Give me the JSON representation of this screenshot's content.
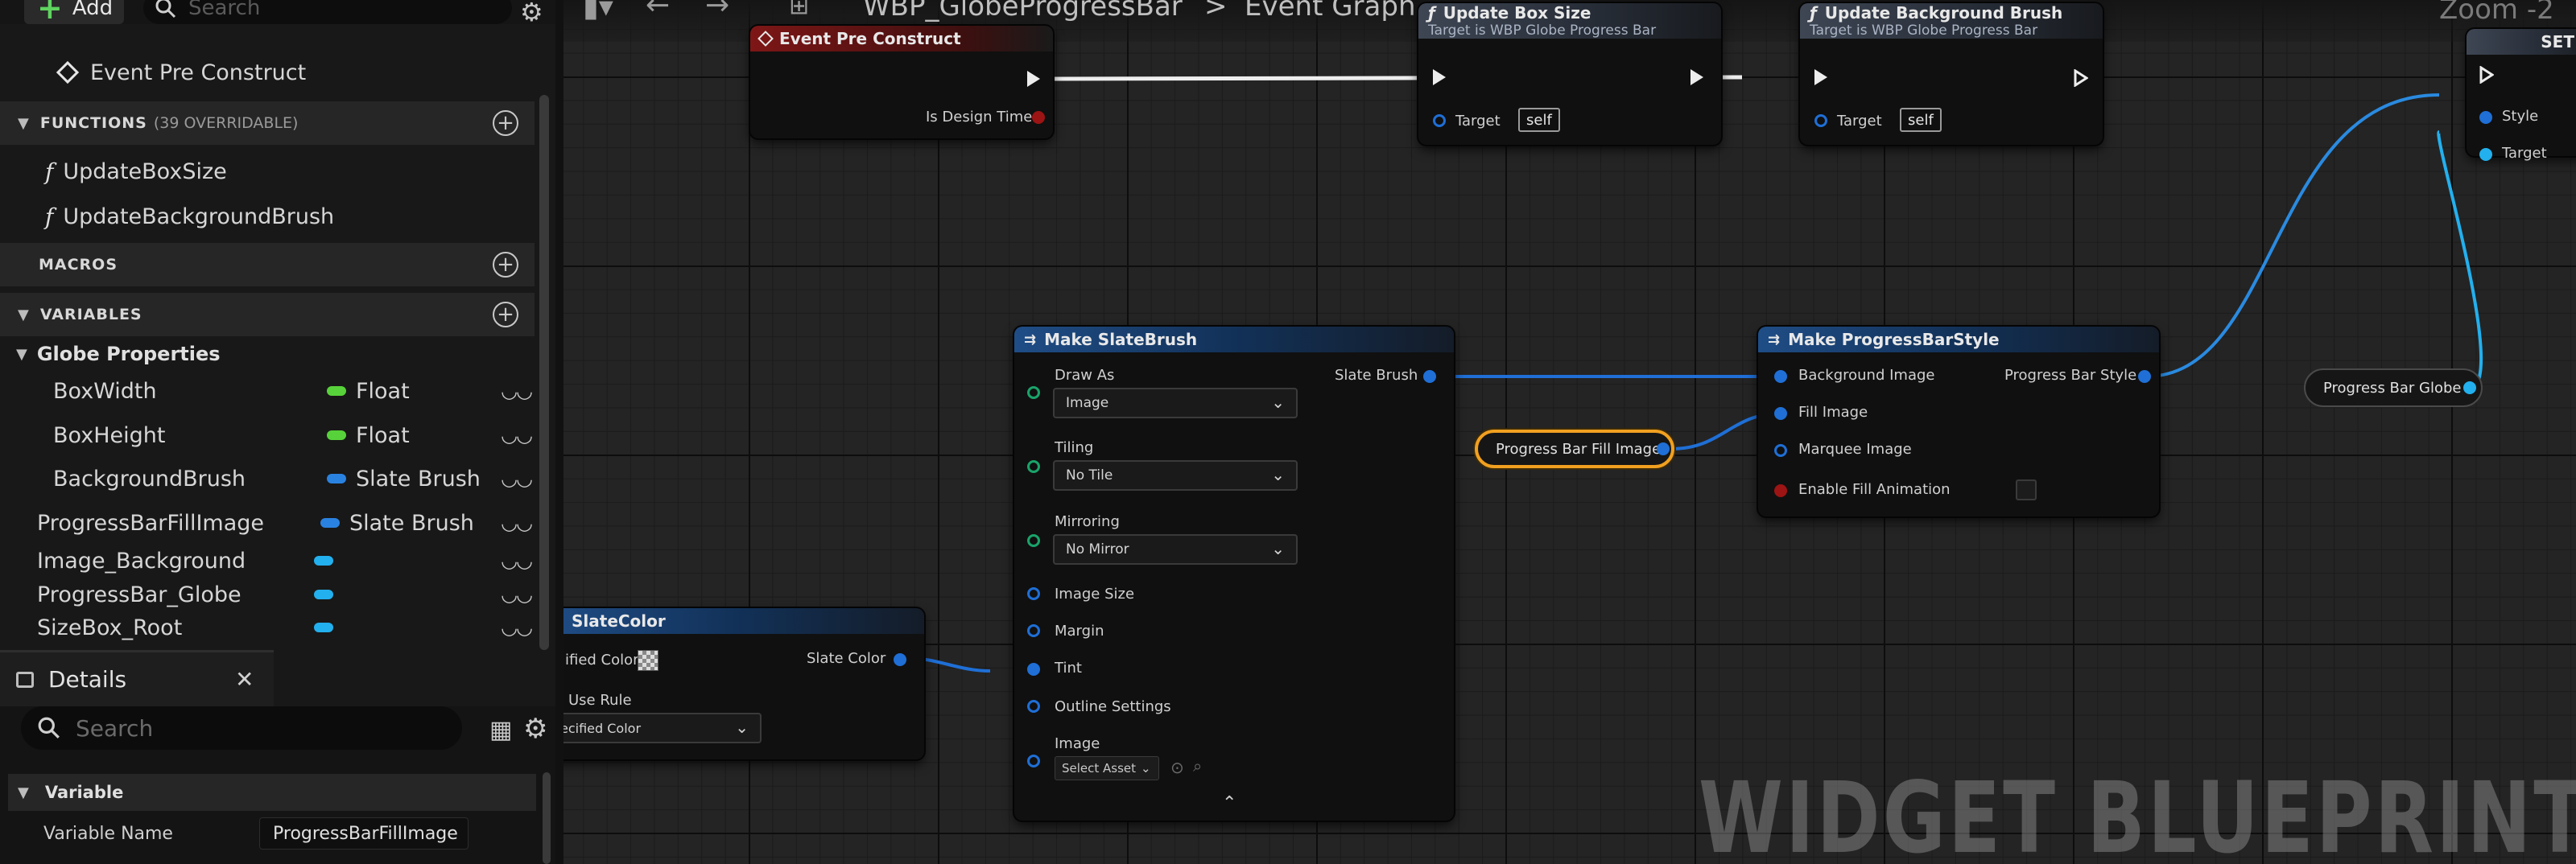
{
  "toolbar": {
    "add_label": "Add",
    "search_placeholder": "Search"
  },
  "my_blueprint": {
    "event_item": "Event Pre Construct",
    "functions_header": "FUNCTIONS",
    "functions_count": "(39 OVERRIDABLE)",
    "functions": [
      "UpdateBoxSize",
      "UpdateBackgroundBrush"
    ],
    "macros_header": "MACROS",
    "variables_header": "VARIABLES",
    "category": "Globe Properties",
    "variables": [
      {
        "name": "BoxWidth",
        "type": "Float"
      },
      {
        "name": "BoxHeight",
        "type": "Float"
      },
      {
        "name": "BackgroundBrush",
        "type": "Slate Brush"
      },
      {
        "name": "ProgressBarFillImage",
        "type": "Slate Brush"
      },
      {
        "name": "Image_Background",
        "type": ""
      },
      {
        "name": "ProgressBar_Globe",
        "type": ""
      },
      {
        "name": "SizeBox_Root",
        "type": ""
      }
    ]
  },
  "details": {
    "tab_label": "Details",
    "search_placeholder": "Search",
    "section": "Variable",
    "variable_name_label": "Variable Name",
    "variable_name_value": "ProgressBarFillImage"
  },
  "graph": {
    "breadcrumb_asset": "WBP_GlobeProgressBar",
    "breadcrumb_sep": ">",
    "breadcrumb_graph": "Event Graph",
    "zoom": "Zoom -2",
    "watermark": "WIDGET BLUEPRINT",
    "nodes": {
      "event_pre_construct": {
        "title": "Event Pre Construct",
        "pin_design_time": "Is Design Time"
      },
      "update_box_size": {
        "title": "Update Box Size",
        "subtitle": "Target is WBP Globe Progress Bar",
        "target_label": "Target",
        "target_value": "self"
      },
      "update_background_brush": {
        "title": "Update Background Brush",
        "subtitle": "Target is WBP Globe Progress Bar",
        "target_label": "Target",
        "target_value": "self"
      },
      "set_node": {
        "title": "SET",
        "pin_style": "Style",
        "pin_target": "Target"
      },
      "make_slate_brush": {
        "title": "Make SlateBrush",
        "out_pin": "Slate Brush",
        "draw_as_label": "Draw As",
        "draw_as_value": "Image",
        "tiling_label": "Tiling",
        "tiling_value": "No Tile",
        "mirroring_label": "Mirroring",
        "mirroring_value": "No Mirror",
        "image_size": "Image Size",
        "margin": "Margin",
        "tint": "Tint",
        "outline_settings": "Outline Settings",
        "image": "Image",
        "select_asset": "Select Asset"
      },
      "slate_color": {
        "title": "SlateColor",
        "specified_color": "ified Color",
        "out_pin": "Slate Color",
        "use_rule": "Use Rule",
        "use_rule_value": "ecified Color"
      },
      "make_progress_bar_style": {
        "title": "Make ProgressBarStyle",
        "pins": [
          "Background Image",
          "Fill Image",
          "Marquee Image",
          "Enable Fill Animation"
        ],
        "out_pin": "Progress Bar Style"
      },
      "get_fill_image": {
        "label": "Progress Bar Fill Image"
      },
      "get_progress_bar_globe": {
        "label": "Progress Bar Globe"
      }
    }
  }
}
